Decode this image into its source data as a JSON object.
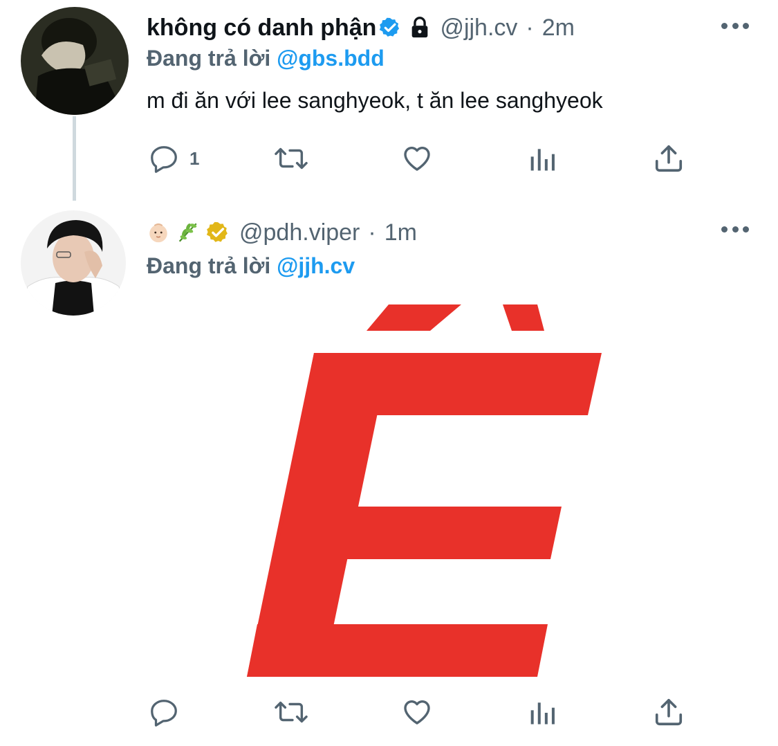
{
  "thread": [
    {
      "display_name": "không có danh phận",
      "handle": "@jjh.cv",
      "separator": "·",
      "time": "2m",
      "verified_badge": "blue-verified-icon",
      "lock": "lock-icon",
      "replying_prefix": "Đang trả lời",
      "replying_to": "@gbs.bdd",
      "text": "m đi ăn với lee sanghyeok, t ăn lee sanghyeok",
      "reply_count": "1"
    },
    {
      "display_name_emojis": [
        "baby-face-icon",
        "herb-icon"
      ],
      "verified_badge": "gold-verified-icon",
      "handle": "@pdh.viper",
      "separator": "·",
      "time": "1m",
      "replying_prefix": "Đang trả lời",
      "replying_to": "@jjh.cv",
      "media_letter": "Ề"
    }
  ],
  "colors": {
    "accent": "#1d9bf0",
    "secondary_text": "#536471",
    "gold_badge": "#e2b719",
    "media_red": "#e8312a",
    "thread_line": "#cfd9de"
  }
}
